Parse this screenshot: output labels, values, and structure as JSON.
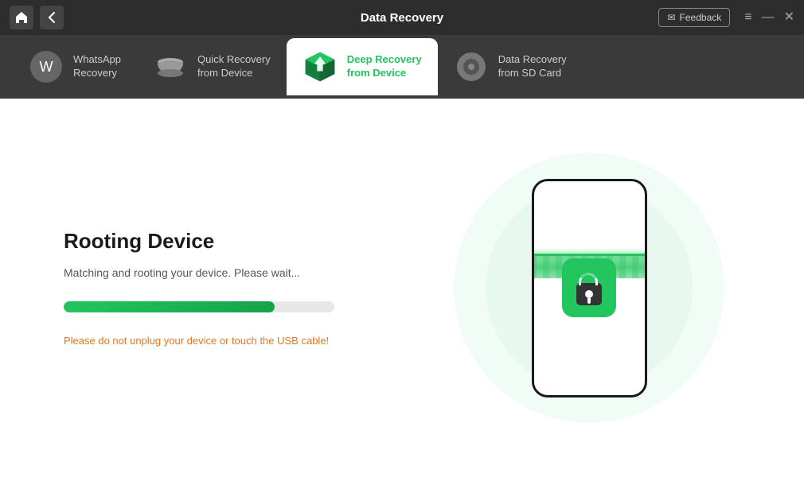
{
  "titleBar": {
    "title": "Data Recovery",
    "homeBtn": "⌂",
    "backBtn": "‹",
    "feedback": {
      "icon": "✉",
      "label": "Feedback"
    },
    "windowControls": {
      "menu": "≡",
      "minimize": "—",
      "close": "✕"
    }
  },
  "tabs": [
    {
      "id": "whatsapp",
      "label1": "WhatsApp",
      "label2": "Recovery",
      "active": false
    },
    {
      "id": "quick",
      "label1": "Quick Recovery",
      "label2": "from Device",
      "active": false
    },
    {
      "id": "deep",
      "label1": "Deep Recovery",
      "label2": "from Device",
      "active": true
    },
    {
      "id": "sdcard",
      "label1": "Data Recovery",
      "label2": "from SD Card",
      "active": false
    }
  ],
  "main": {
    "heading": "Rooting Device",
    "description": "Matching and rooting your device. Please wait...",
    "progressPercent": 78,
    "warningText": "Please do not unplug your device or touch the USB cable!"
  },
  "colors": {
    "green": "#22c55e",
    "orange": "#e07820",
    "darkBg": "#2d2d2d",
    "tabBg": "#3a3a3a"
  }
}
